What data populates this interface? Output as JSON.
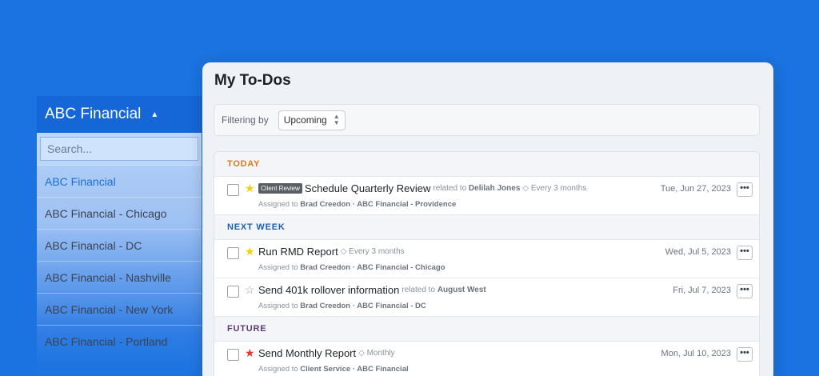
{
  "org_dropdown": {
    "selected": "ABC Financial",
    "search_placeholder": "Search...",
    "items": [
      {
        "label": "ABC Financial",
        "active": true
      },
      {
        "label": "ABC Financial - Chicago"
      },
      {
        "label": "ABC Financial - DC"
      },
      {
        "label": "ABC Financial - Nashville"
      },
      {
        "label": "ABC Financial - New York"
      },
      {
        "label": "ABC Financial - Portland"
      }
    ]
  },
  "todos": {
    "title": "My To-Dos",
    "filter_label": "Filtering by",
    "filter_value": "Upcoming",
    "sections": [
      {
        "heading": "TODAY",
        "rows": [
          {
            "tag": "Client Review",
            "name": "Schedule Quarterly Review",
            "related_prefix": "related to",
            "related": "Delilah Jones",
            "recurrence": "◇ Every 3 months",
            "assigned_prefix": "Assigned to",
            "assigned": "Brad Creedon · ABC Financial - Providence",
            "date": "Tue, Jun 27, 2023",
            "star": "yellow"
          }
        ]
      },
      {
        "heading": "NEXT WEEK",
        "rows": [
          {
            "name": "Run RMD Report",
            "recurrence": "◇ Every 3 months",
            "assigned_prefix": "Assigned to",
            "assigned": "Brad Creedon · ABC Financial - Chicago",
            "date": "Wed, Jul 5, 2023",
            "star": "yellow"
          },
          {
            "name": "Send 401k rollover information",
            "related_prefix": "related to",
            "related": "August West",
            "assigned_prefix": "Assigned to",
            "assigned": "Brad Creedon · ABC Financial - DC",
            "date": "Fri, Jul 7, 2023",
            "star": "empty"
          }
        ]
      },
      {
        "heading": "FUTURE",
        "rows": [
          {
            "name": "Send Monthly Report",
            "recurrence": "◇ Monthly",
            "assigned_prefix": "Assigned to",
            "assigned": "Client Service · ABC Financial",
            "date": "Mon, Jul 10, 2023",
            "star": "red"
          }
        ]
      }
    ],
    "more_label": "•••"
  },
  "colors": {
    "background": "#1a73e0",
    "today": "#d97a18",
    "next_week": "#1f5fa8",
    "future": "#5b3a78"
  },
  "icons": {
    "caret": "caret-up-icon",
    "star": "star-icon",
    "more": "more-horizontal-icon",
    "select_arrows": "updown-arrows-icon"
  }
}
